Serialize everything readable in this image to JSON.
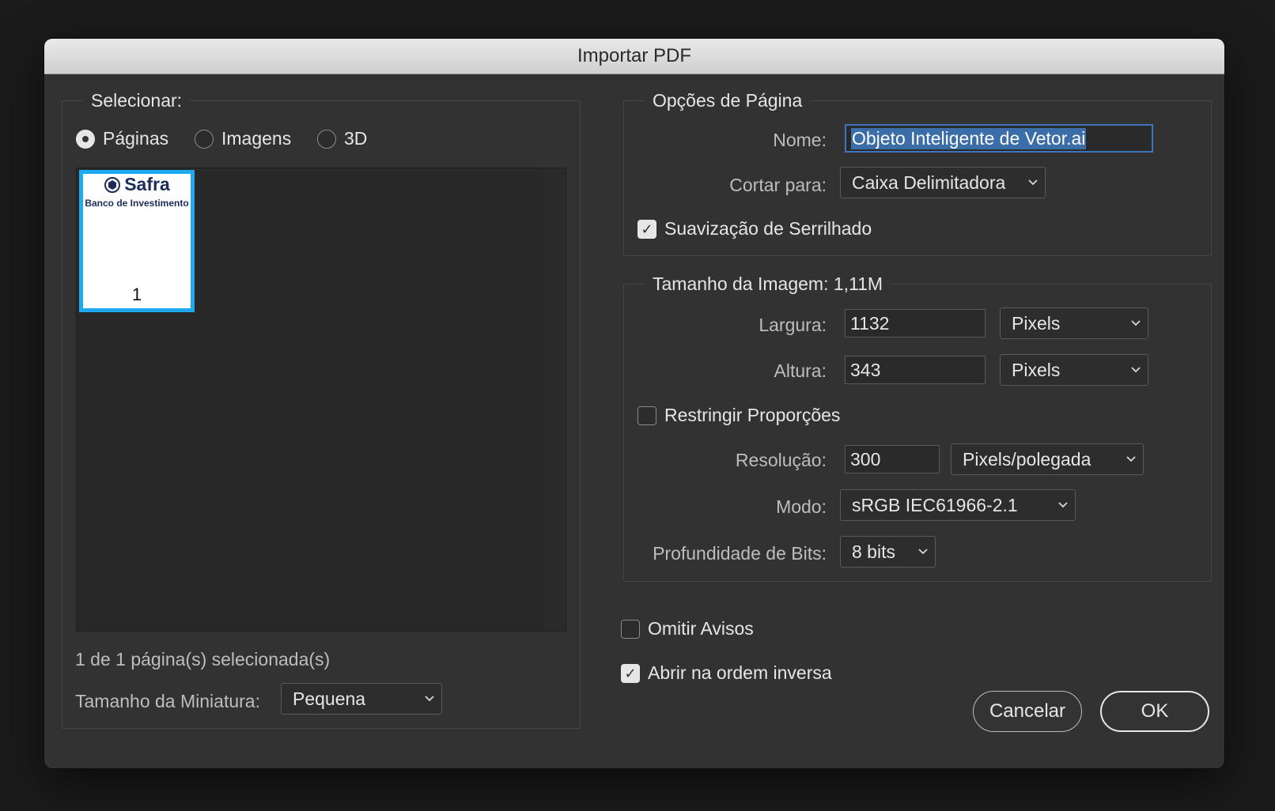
{
  "window": {
    "title": "Importar PDF"
  },
  "select_group": {
    "legend": "Selecionar:",
    "radios": [
      {
        "label": "Páginas",
        "checked": true
      },
      {
        "label": "Imagens",
        "checked": false
      },
      {
        "label": "3D",
        "checked": false
      }
    ],
    "thumbnail": {
      "logo_text": "Safra",
      "subtitle": "Banco de Investimento",
      "page_number": "1"
    },
    "selection_status": "1 de 1 página(s) selecionada(s)",
    "thumb_size_label": "Tamanho da Miniatura:",
    "thumb_size_value": "Pequena"
  },
  "page_options": {
    "legend": "Opções de Página",
    "name_label": "Nome:",
    "name_value": "Objeto Inteligente de Vetor.ai",
    "crop_label": "Cortar para:",
    "crop_value": "Caixa Delimitadora",
    "antialias_label": "Suavização de Serrilhado",
    "antialias_checked": true
  },
  "image_size": {
    "legend": "Tamanho da Imagem: 1,11M",
    "width_label": "Largura:",
    "width_value": "1132",
    "width_unit": "Pixels",
    "height_label": "Altura:",
    "height_value": "343",
    "height_unit": "Pixels",
    "constrain_label": "Restringir Proporções",
    "constrain_checked": false,
    "resolution_label": "Resolução:",
    "resolution_value": "300",
    "resolution_unit": "Pixels/polegada",
    "mode_label": "Modo:",
    "mode_value": "sRGB IEC61966-2.1",
    "bitdepth_label": "Profundidade de Bits:",
    "bitdepth_value": "8 bits"
  },
  "options": {
    "suppress_warnings_label": "Omitir Avisos",
    "suppress_warnings_checked": false,
    "reverse_order_label": "Abrir na ordem inversa",
    "reverse_order_checked": true
  },
  "buttons": {
    "cancel": "Cancelar",
    "ok": "OK"
  },
  "colors": {
    "accent": "#1eaaf1",
    "selection": "#3b6ea8",
    "background": "#323232"
  }
}
